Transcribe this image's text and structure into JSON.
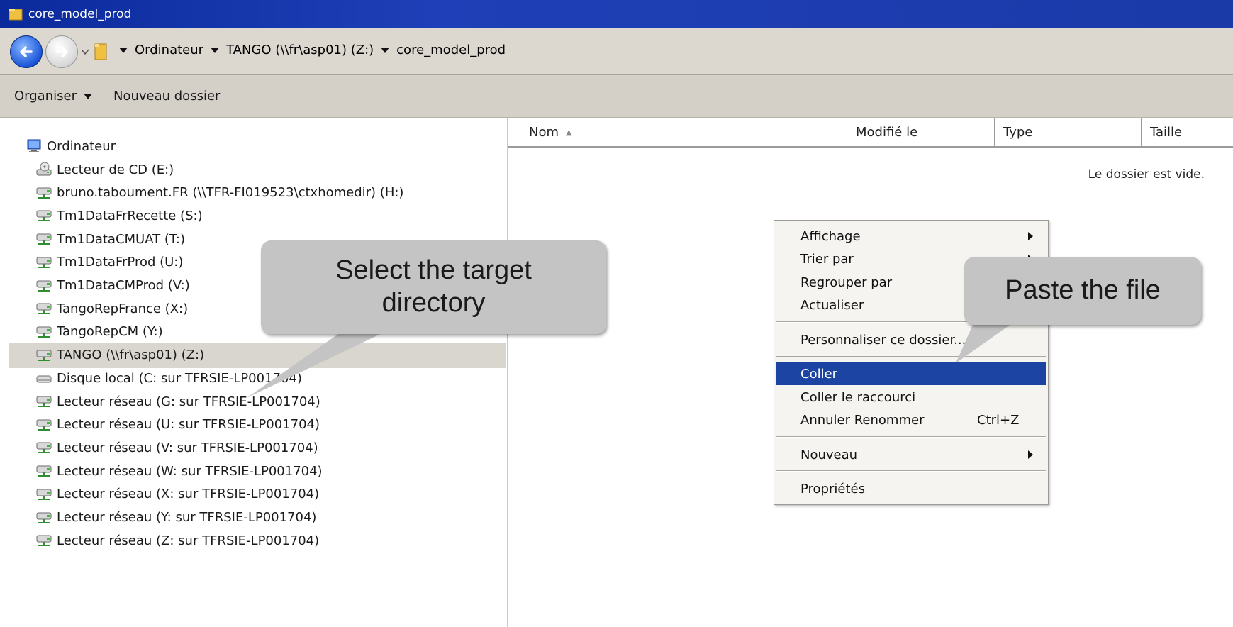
{
  "window": {
    "title": "core_model_prod"
  },
  "address": {
    "crumbs": [
      "Ordinateur",
      "TANGO (\\\\fr\\asp01) (Z:)",
      "core_model_prod"
    ]
  },
  "toolbar": {
    "organise_label": "Organiser",
    "new_folder_label": "Nouveau dossier"
  },
  "tree": {
    "root_label": "Ordinateur",
    "items": [
      {
        "label": "Lecteur de CD (E:)",
        "icon": "cd-drive-icon"
      },
      {
        "label": "bruno.taboument.FR (\\\\TFR-FI019523\\ctxhomedir) (H:)",
        "icon": "network-drive-icon"
      },
      {
        "label": "Tm1DataFrRecette (S:)",
        "icon": "network-drive-icon"
      },
      {
        "label": "Tm1DataCMUAT (T:)",
        "icon": "network-drive-icon"
      },
      {
        "label": "Tm1DataFrProd (U:)",
        "icon": "network-drive-icon"
      },
      {
        "label": "Tm1DataCMProd (V:)",
        "icon": "network-drive-icon"
      },
      {
        "label": "TangoRepFrance (X:)",
        "icon": "network-drive-icon"
      },
      {
        "label": "TangoRepCM (Y:)",
        "icon": "network-drive-icon"
      },
      {
        "label": "TANGO (\\\\fr\\asp01) (Z:)",
        "icon": "network-drive-icon",
        "selected": true
      },
      {
        "label": "Disque local (C: sur TFRSIE-LP001704)",
        "icon": "local-disk-icon"
      },
      {
        "label": "Lecteur réseau (G: sur TFRSIE-LP001704)",
        "icon": "network-drive-icon"
      },
      {
        "label": "Lecteur réseau (U: sur TFRSIE-LP001704)",
        "icon": "network-drive-icon"
      },
      {
        "label": "Lecteur réseau (V: sur TFRSIE-LP001704)",
        "icon": "network-drive-icon"
      },
      {
        "label": "Lecteur réseau (W: sur TFRSIE-LP001704)",
        "icon": "network-drive-icon"
      },
      {
        "label": "Lecteur réseau (X: sur TFRSIE-LP001704)",
        "icon": "network-drive-icon"
      },
      {
        "label": "Lecteur réseau (Y: sur TFRSIE-LP001704)",
        "icon": "network-drive-icon"
      },
      {
        "label": "Lecteur réseau (Z: sur TFRSIE-LP001704)",
        "icon": "network-drive-icon"
      }
    ]
  },
  "columns": [
    "Nom",
    "Modifié le",
    "Type",
    "Taille"
  ],
  "content": {
    "empty_message": "Le dossier est vide."
  },
  "context_menu": {
    "items": [
      {
        "label": "Affichage",
        "submenu": true
      },
      {
        "label": "Trier par",
        "submenu": true
      },
      {
        "label": "Regrouper par",
        "submenu": true
      },
      {
        "label": "Actualiser"
      },
      {
        "label": "Personnaliser ce dossier..."
      },
      {
        "label": "Coller",
        "highlighted": true
      },
      {
        "label": "Coller le raccourci"
      },
      {
        "label": "Annuler Renommer",
        "shortcut": "Ctrl+Z"
      },
      {
        "label": "Nouveau",
        "submenu": true
      },
      {
        "label": "Propriétés"
      }
    ]
  },
  "callouts": {
    "select_target": "Select the target directory",
    "paste_file": "Paste the file"
  },
  "colors": {
    "highlight": "#1b44a3",
    "callout": "#c4c4c4",
    "titlebar": "#0a2a9c"
  }
}
